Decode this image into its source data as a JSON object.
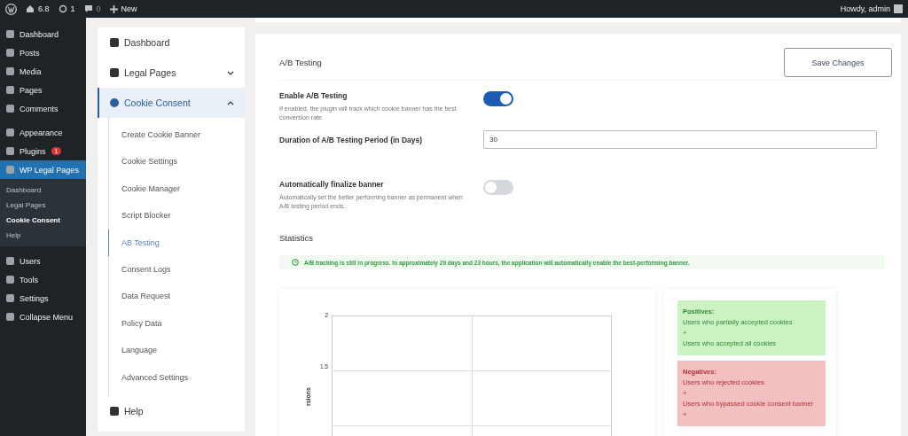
{
  "admin_bar": {
    "version": "6.8",
    "updates": "1",
    "comments": "0",
    "new": "New",
    "greeting": "Howdy, admin"
  },
  "admin_menu": [
    {
      "label": "Dashboard",
      "selected": false
    },
    {
      "label": "Posts",
      "selected": false
    },
    {
      "label": "Media",
      "selected": false
    },
    {
      "label": "Pages",
      "selected": false
    },
    {
      "label": "Comments",
      "selected": false
    },
    {
      "label": "Appearance",
      "selected": false
    },
    {
      "label": "Plugins",
      "selected": false,
      "badge": "1"
    },
    {
      "label": "WP Legal Pages",
      "selected": true,
      "children": [
        {
          "label": "Dashboard",
          "selected": false
        },
        {
          "label": "Legal Pages",
          "selected": false
        },
        {
          "label": "Cookie Consent",
          "selected": true
        },
        {
          "label": "Help",
          "selected": false
        }
      ]
    },
    {
      "label": "Users",
      "selected": false
    },
    {
      "label": "Tools",
      "selected": false
    },
    {
      "label": "Settings",
      "selected": false
    },
    {
      "label": "Collapse Menu",
      "selected": false
    }
  ],
  "plugin_nav": [
    {
      "label": "Dashboard",
      "selected": false
    },
    {
      "label": "Legal Pages",
      "selected": false,
      "expanded": false
    },
    {
      "label": "Cookie Consent",
      "selected": true,
      "expanded": true,
      "children": [
        {
          "label": "Create Cookie Banner",
          "selected": false
        },
        {
          "label": "Cookie Settings",
          "selected": false
        },
        {
          "label": "Cookie Manager",
          "selected": false
        },
        {
          "label": "Script Blocker",
          "selected": false
        },
        {
          "label": "AB Testing",
          "selected": true
        },
        {
          "label": "Consent Logs",
          "selected": false
        },
        {
          "label": "Data Request",
          "selected": false
        },
        {
          "label": "Policy Data",
          "selected": false
        },
        {
          "label": "Language",
          "selected": false
        },
        {
          "label": "Advanced Settings",
          "selected": false
        }
      ]
    },
    {
      "label": "Help",
      "selected": false
    }
  ],
  "settings": {
    "title": "A/B Testing",
    "save_button": "Save Changes",
    "rows": [
      {
        "kind": "toggle",
        "label": "Enable A/B Testing",
        "description": "If enabled, the plugin will track which cookie banner has the best conversion rate.",
        "on": true
      },
      {
        "kind": "number",
        "label": "Duration of A/B Testing Period (in Days)",
        "value": "30"
      },
      {
        "kind": "toggle",
        "label": "Automatically finalize banner",
        "description": "Automatically set the better performing banner as permanent when A/B testing period ends.",
        "on": false
      }
    ]
  },
  "statistics": {
    "title": "Statistics",
    "notice": "A/B tracking is still in progress. In approximately 29 days and 23 hours, the application will automatically enable the best-performing banner.",
    "chart": {
      "y_tick_labels": [
        "2",
        "1.5"
      ],
      "y_axis_label": "rsions"
    },
    "legend": [
      {
        "kind": "positive",
        "title": "Positives:",
        "lines": [
          "Users who partially accepted cookies",
          "+",
          "Users who accepted all cookies"
        ]
      },
      {
        "kind": "negative",
        "title": "Negatives:",
        "lines": [
          "Users who rejected cookies",
          "+",
          "Users who bypassed cookie consent banner",
          "+"
        ]
      }
    ]
  }
}
